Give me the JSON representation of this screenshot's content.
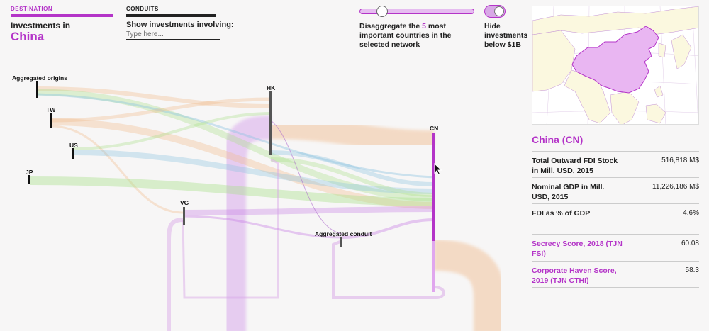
{
  "tabs": {
    "destination": "Destination",
    "conduits": "Conduits"
  },
  "destination": {
    "heading": "Investments in",
    "name": "China"
  },
  "conduits": {
    "heading": "Show investments involving:",
    "placeholder": "Type here..."
  },
  "slider": {
    "value": 5,
    "text_before": "Disaggregate the ",
    "text_after": " most important countries in the selected network"
  },
  "toggle": {
    "on": true,
    "text": "Hide investments below $1B"
  },
  "colors": {
    "accent": "#b434c8",
    "flow_green": "#a8e08a",
    "flow_orange": "#f0b98a",
    "flow_blue": "#8ac3e0",
    "flow_purple": "#c77fe6"
  },
  "nodes": {
    "aggregated_origins": "Aggregated origins",
    "tw": "TW",
    "us": "US",
    "jp": "JP",
    "hk": "HK",
    "vg": "VG",
    "cn": "CN",
    "aggregated_conduit": "Aggregated conduit"
  },
  "country": {
    "title": "China (CN)",
    "stats": [
      {
        "label": "Total Outward FDI Stock in Mill. USD, 2015",
        "value": "516,818 M$"
      },
      {
        "label": "Nominal GDP in Mill. USD, 2015",
        "value": "11,226,186 M$"
      },
      {
        "label": "FDI as % of GDP",
        "value": "4.6%"
      },
      {
        "label": "Secrecy Score, 2018 (TJN FSI)",
        "value": "60.08"
      },
      {
        "label": "Corporate Haven Score, 2019 (TJN CTHI)",
        "value": "58.3"
      }
    ]
  }
}
